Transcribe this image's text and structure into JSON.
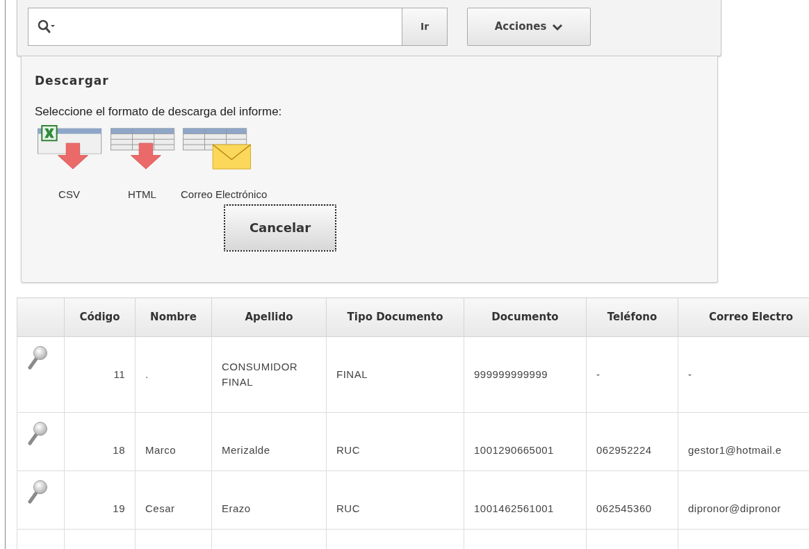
{
  "search": {
    "go_button": "Ir",
    "actions_button": "Acciones"
  },
  "download": {
    "title": "Descargar",
    "prompt": "Seleccione el formato de descarga del informe:",
    "formats": [
      {
        "kind": "csv",
        "label": "CSV"
      },
      {
        "kind": "html",
        "label": "HTML"
      },
      {
        "kind": "email",
        "label": "Correo Electrónico"
      }
    ],
    "cancel_button": {
      "label": "Cancelar",
      "focused": true
    }
  },
  "table": {
    "columns": [
      "Código",
      "Nombre",
      "Apellido",
      "Tipo Documento",
      "Documento",
      "Teléfono",
      "Correo Electro"
    ],
    "rows": [
      [
        "11",
        ".",
        "CONSUMIDOR FINAL",
        "FINAL",
        "999999999999",
        "-",
        "-"
      ],
      [
        "18",
        "Marco",
        "Merizalde",
        "RUC",
        "1001290665001",
        "062952224",
        "gestor1@hotmail.e"
      ],
      [
        "19",
        "Cesar",
        "Erazo",
        "RUC",
        "1001462561001",
        "062545360",
        "dipronor@dipronor"
      ]
    ]
  }
}
